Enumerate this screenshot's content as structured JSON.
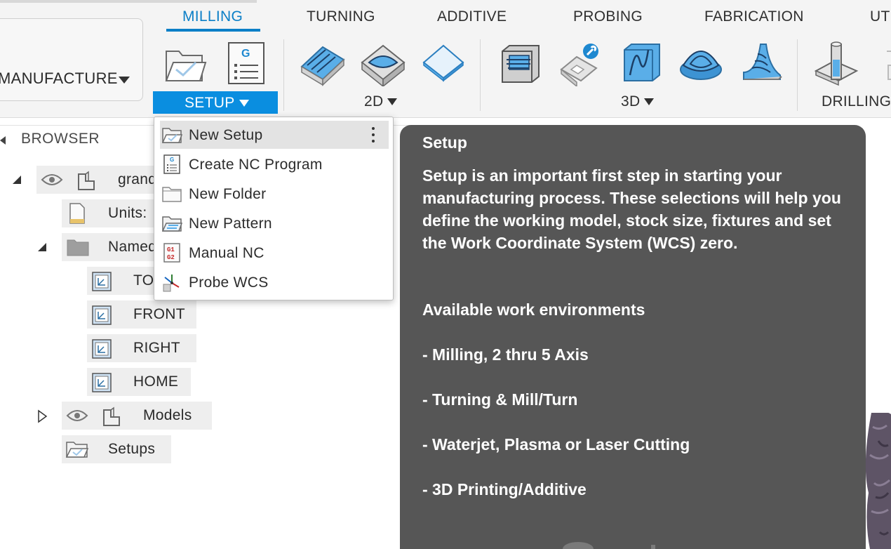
{
  "toolbar": {
    "workspace_label": "MANUFACTURE",
    "tabs": [
      {
        "label": "MILLING",
        "active": true
      },
      {
        "label": "TURNING",
        "active": false
      },
      {
        "label": "ADDITIVE",
        "active": false
      },
      {
        "label": "PROBING",
        "active": false
      },
      {
        "label": "FABRICATION",
        "active": false
      },
      {
        "label": "UT",
        "active": false
      }
    ],
    "groups": {
      "setup": "SETUP",
      "g2d": "2D",
      "g3d": "3D",
      "drilling": "DRILLING"
    },
    "accent_color": "#0a8ee0"
  },
  "browser": {
    "title": "BROWSER",
    "nodes": {
      "root": "grand",
      "units": "Units:",
      "named_views": "Named",
      "top": "TO",
      "front": "FRONT",
      "right": "RIGHT",
      "home": "HOME",
      "models": "Models",
      "setups": "Setups"
    }
  },
  "setup_menu": {
    "items": [
      {
        "label": "New Setup",
        "icon": "new-setup-icon",
        "highlighted": true
      },
      {
        "label": "Create NC Program",
        "icon": "nc-program-icon"
      },
      {
        "label": "New Folder",
        "icon": "folder-icon"
      },
      {
        "label": "New Pattern",
        "icon": "pattern-icon"
      },
      {
        "label": "Manual NC",
        "icon": "manual-nc-icon"
      },
      {
        "label": "Probe WCS",
        "icon": "probe-wcs-icon"
      }
    ]
  },
  "tooltip": {
    "title": "Setup",
    "description": "Setup is an important first step in starting your manufacturing process. These selections will help you define the working model, stock size, fixtures and set the Work Coordinate System (WCS) zero.",
    "env_heading": "Available work environments",
    "environments": [
      "- Milling, 2 thru 5 Axis",
      "- Turning & Mill/Turn",
      "- Waterjet, Plasma or Laser Cutting",
      "- 3D Printing/Additive"
    ]
  }
}
